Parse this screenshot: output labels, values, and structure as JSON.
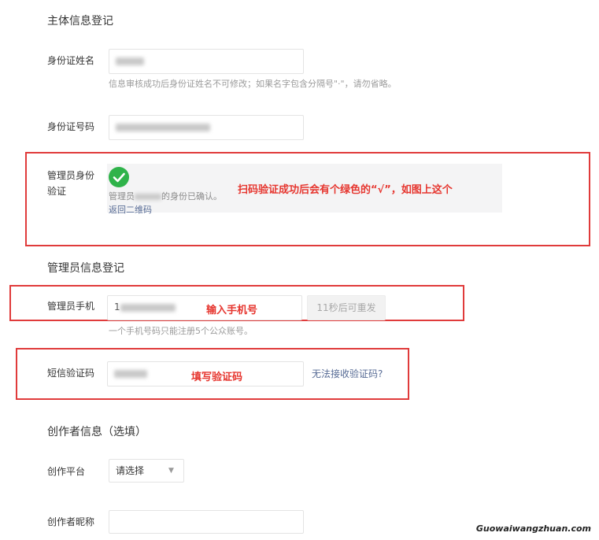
{
  "sections": {
    "subject_title": "主体信息登记",
    "admin_title": "管理员信息登记",
    "creator_title": "创作者信息（选填）"
  },
  "id_name": {
    "label": "身份证姓名",
    "hint": "信息审核成功后身份证姓名不可修改；如果名字包含分隔号\"·\"，请勿省略。"
  },
  "id_number": {
    "label": "身份证号码"
  },
  "admin_verify": {
    "label_line1": "管理员身份",
    "label_line2": "验证",
    "status_prefix": "管理员",
    "status_suffix": "的身份已确认。",
    "back_link": "返回二维码",
    "annotation": "扫码验证成功后会有个绿色的“√”，如图上这个"
  },
  "admin_phone": {
    "label": "管理员手机",
    "value_prefix": "1",
    "resend_button": "11秒后可重发",
    "annotation": "输入手机号",
    "hint": "一个手机号码只能注册5个公众账号。"
  },
  "sms_code": {
    "label": "短信验证码",
    "no_code_link": "无法接收验证码?",
    "annotation": "填写验证码"
  },
  "creator_platform": {
    "label": "创作平台",
    "select_value": "请选择"
  },
  "creator_nickname": {
    "label": "创作者昵称"
  },
  "watermark": "Guowaiwangzhuan.com",
  "colors": {
    "annotation_red": "#e03b3b",
    "success_green": "#2fb34a",
    "link_blue": "#576b95"
  }
}
